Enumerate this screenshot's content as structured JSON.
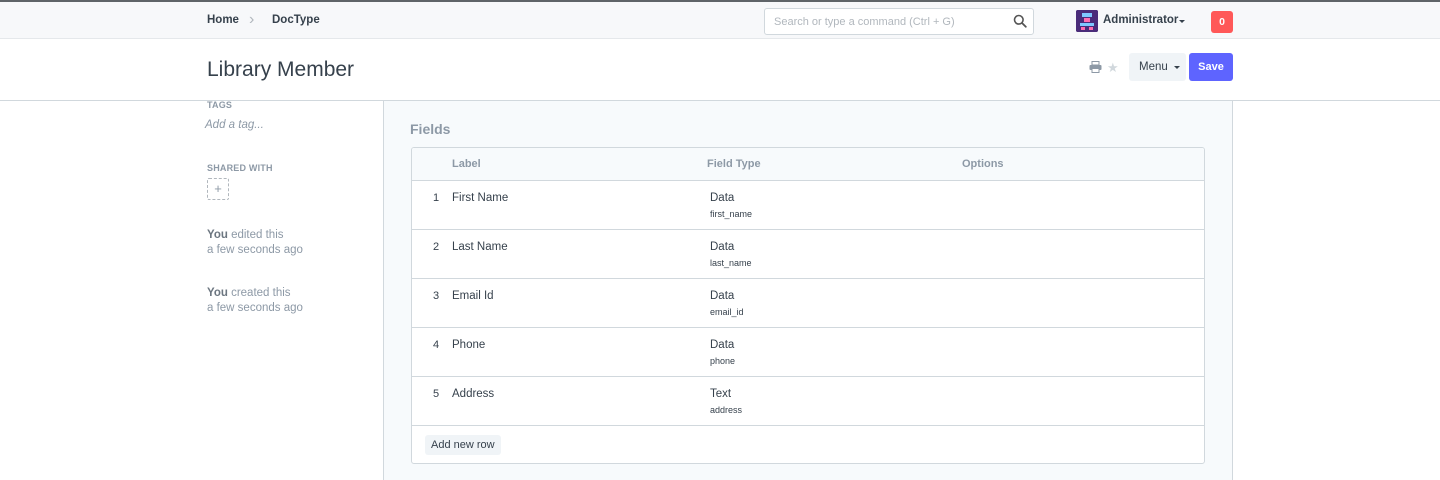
{
  "navbar": {
    "breadcrumbs": [
      "Home",
      "DocType"
    ],
    "search_placeholder": "Search or type a command (Ctrl + G)",
    "user_name": "Administrator",
    "notification_count": "0",
    "colors": {
      "notification": "#ff5858",
      "avatar": "#4a2c7a"
    }
  },
  "page_head": {
    "title": "Library Member",
    "menu_label": "Menu",
    "save_label": "Save",
    "icons": [
      "print-icon",
      "star-icon"
    ],
    "colors": {
      "primary": "#5e64ff"
    }
  },
  "sidebar": {
    "tags_label": "TAGS",
    "add_tag": "Add a tag...",
    "shared_label": "SHARED WITH",
    "share_add_symbol": "+",
    "activity": [
      {
        "who": "You",
        "action": "edited this",
        "when": "a few seconds ago"
      },
      {
        "who": "You",
        "action": "created this",
        "when": "a few seconds ago"
      }
    ]
  },
  "form": {
    "section_title": "Fields",
    "columns": [
      "Label",
      "Field Type",
      "Options"
    ],
    "rows": [
      {
        "idx": "1",
        "label": "First Name",
        "type": "Data",
        "fieldname": "first_name",
        "options": ""
      },
      {
        "idx": "2",
        "label": "Last Name",
        "type": "Data",
        "fieldname": "last_name",
        "options": ""
      },
      {
        "idx": "3",
        "label": "Email Id",
        "type": "Data",
        "fieldname": "email_id",
        "options": ""
      },
      {
        "idx": "4",
        "label": "Phone",
        "type": "Data",
        "fieldname": "phone",
        "options": ""
      },
      {
        "idx": "5",
        "label": "Address",
        "type": "Text",
        "fieldname": "address",
        "options": ""
      }
    ],
    "add_row_label": "Add new row"
  }
}
